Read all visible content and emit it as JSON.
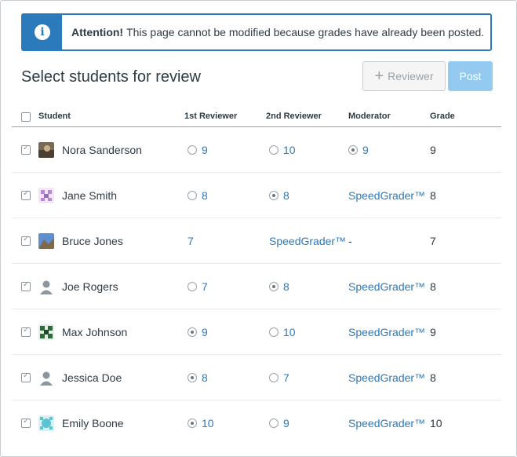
{
  "alert": {
    "icon": "info-icon",
    "icon_glyph": "i",
    "strong": "Attention!",
    "message": "This page cannot be modified because grades have already been posted."
  },
  "page": {
    "title": "Select students for review"
  },
  "toolbar": {
    "reviewer_plus": "+",
    "reviewer_label": "Reviewer",
    "post_label": "Post"
  },
  "table": {
    "headers": {
      "student": "Student",
      "first_reviewer": "1st Reviewer",
      "second_reviewer": "2nd Reviewer",
      "moderator": "Moderator",
      "grade": "Grade"
    },
    "rows": [
      {
        "name": "Nora Sanderson",
        "avatar": "photo-avatar",
        "r1": {
          "value": "9",
          "radio": true,
          "selected": false
        },
        "r2": {
          "value": "10",
          "radio": true,
          "selected": false
        },
        "mod": {
          "value": "9",
          "radio": true,
          "selected": true
        },
        "grade": "9"
      },
      {
        "name": "Jane Smith",
        "avatar": "pattern-avatar-purple",
        "r1": {
          "value": "8",
          "radio": true,
          "selected": false
        },
        "r2": {
          "value": "8",
          "radio": true,
          "selected": true
        },
        "mod": {
          "value": "SpeedGrader™",
          "radio": false,
          "selected": false
        },
        "grade": "8"
      },
      {
        "name": "Bruce Jones",
        "avatar": "landscape-avatar",
        "r1": {
          "value": "7",
          "radio": false,
          "selected": false
        },
        "r2": {
          "value": "SpeedGrader™",
          "radio": false,
          "selected": false
        },
        "mod": {
          "value": "-",
          "radio": false,
          "selected": false,
          "plain": true
        },
        "grade": "7"
      },
      {
        "name": "Joe Rogers",
        "avatar": "default-user-avatar",
        "r1": {
          "value": "7",
          "radio": true,
          "selected": false
        },
        "r2": {
          "value": "8",
          "radio": true,
          "selected": true
        },
        "mod": {
          "value": "SpeedGrader™",
          "radio": false,
          "selected": false
        },
        "grade": "8"
      },
      {
        "name": "Max Johnson",
        "avatar": "pattern-avatar-green",
        "r1": {
          "value": "9",
          "radio": true,
          "selected": true
        },
        "r2": {
          "value": "10",
          "radio": true,
          "selected": false
        },
        "mod": {
          "value": "SpeedGrader™",
          "radio": false,
          "selected": false
        },
        "grade": "9"
      },
      {
        "name": "Jessica Doe",
        "avatar": "default-user-avatar",
        "r1": {
          "value": "8",
          "radio": true,
          "selected": true
        },
        "r2": {
          "value": "7",
          "radio": true,
          "selected": false
        },
        "mod": {
          "value": "SpeedGrader™",
          "radio": false,
          "selected": false
        },
        "grade": "8"
      },
      {
        "name": "Emily Boone",
        "avatar": "pattern-avatar-teal",
        "r1": {
          "value": "10",
          "radio": true,
          "selected": true
        },
        "r2": {
          "value": "9",
          "radio": true,
          "selected": false
        },
        "mod": {
          "value": "SpeedGrader™",
          "radio": false,
          "selected": false
        },
        "grade": "10"
      }
    ]
  },
  "colors": {
    "accent": "#2b7abc",
    "text": "#2d3b45",
    "post_button": "#94c9f0"
  }
}
